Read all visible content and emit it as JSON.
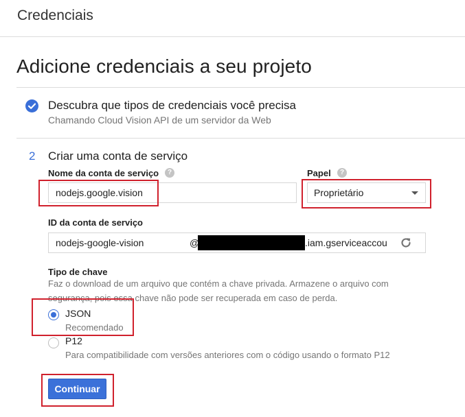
{
  "header": {
    "title": "Credenciais"
  },
  "page": {
    "title": "Adicione credenciais a seu projeto"
  },
  "step1": {
    "status_icon": "check-circle-icon",
    "title": "Descubra que tipos de credenciais você precisa",
    "subtitle": "Chamando Cloud Vision API de um servidor da Web"
  },
  "step2": {
    "number": "2",
    "title": "Criar uma conta de serviço",
    "service_account_name": {
      "label": "Nome da conta de serviço",
      "value": "nodejs.google.vision"
    },
    "role": {
      "label": "Papel",
      "selected": "Proprietário"
    },
    "service_account_id": {
      "label": "ID da conta de serviço",
      "value": "nodejs-google-vision",
      "at": "@",
      "domain_suffix": ".iam.gserviceaccou"
    },
    "key_type": {
      "label": "Tipo de chave",
      "description_line1": "Faz o download de um arquivo que contém a chave privada. Armazene o arquivo com",
      "description_line2": "segurança, pois essa chave não pode ser recuperada em caso de perda.",
      "options": [
        {
          "label": "JSON",
          "sublabel": "Recomendado",
          "selected": true
        },
        {
          "label": "P12",
          "sublabel": "Para compatibilidade com versões anteriores com o código usando o formato P12",
          "selected": false
        }
      ]
    },
    "continue_label": "Continuar"
  },
  "help_icon_glyph": "?",
  "colors": {
    "accent": "#3a6fd8",
    "highlight": "#d0202c"
  }
}
